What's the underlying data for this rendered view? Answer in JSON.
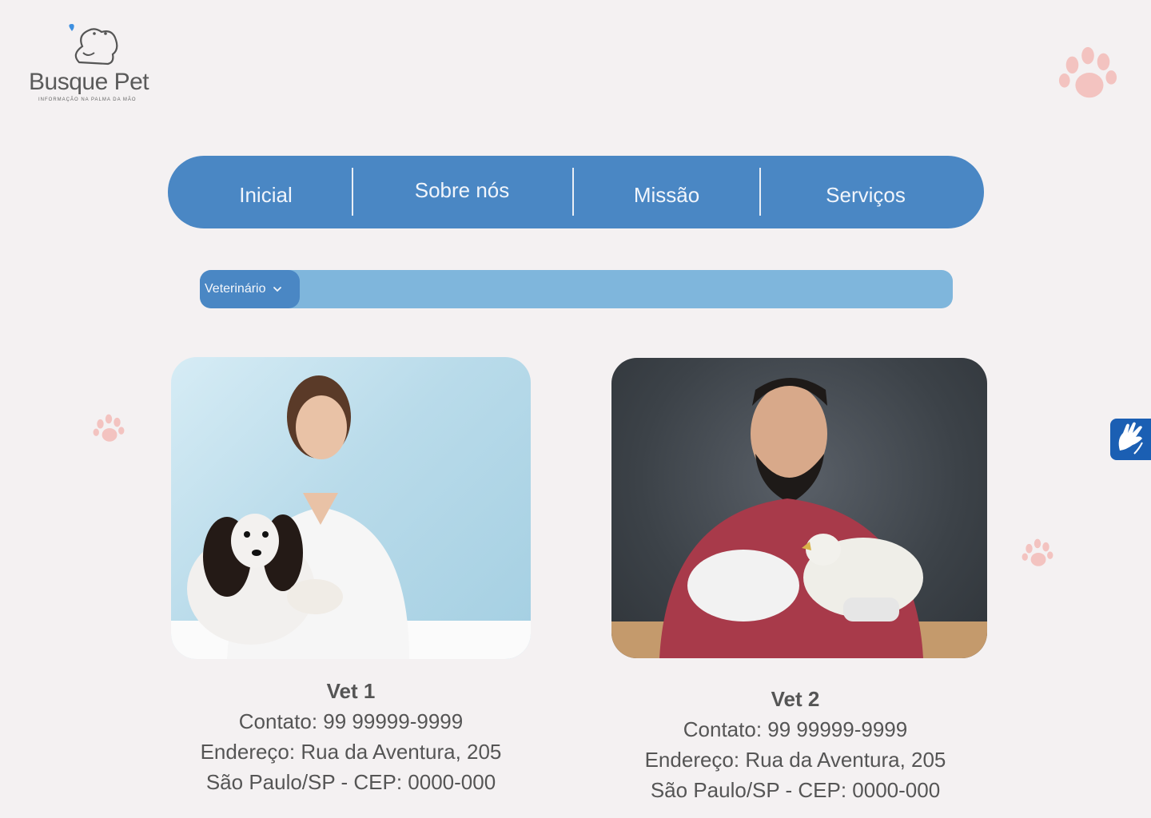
{
  "colors": {
    "background": "#f4f1f2",
    "nav": "#4a87c4",
    "search": "#7fb6dc",
    "paw": "#f3c3c0"
  },
  "brand": {
    "name": "Busque Pet",
    "tagline": "INFORMAÇÃO NA PALMA DA MÃO"
  },
  "nav": {
    "items": [
      {
        "label": "Inicial"
      },
      {
        "label": "Sobre nós"
      },
      {
        "label": "Missão"
      },
      {
        "label": "Serviços"
      }
    ]
  },
  "search": {
    "category": "Veterinário",
    "icon": "chevron-down-icon"
  },
  "vets": [
    {
      "name": "Vet 1",
      "contact": "Contato: 99 99999-9999",
      "address": "Endereço: Rua da Aventura, 205",
      "city": "São Paulo/SP - CEP: 0000-000"
    },
    {
      "name": "Vet 2",
      "contact": "Contato: 99 99999-9999",
      "address": "Endereço: Rua da Aventura, 205",
      "city": "São Paulo/SP - CEP: 0000-000"
    }
  ],
  "accessibility": {
    "icon": "sign-language-icon"
  }
}
